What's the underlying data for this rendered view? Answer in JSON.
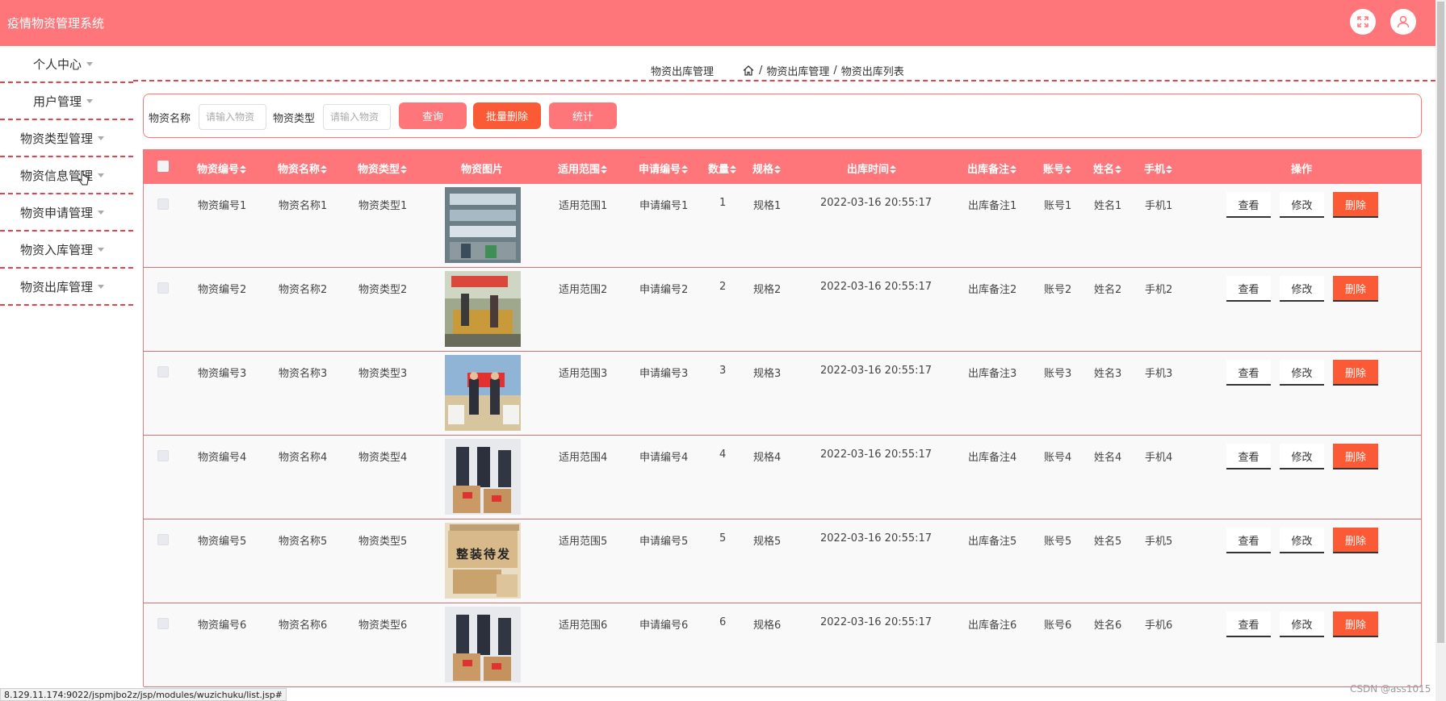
{
  "app": {
    "title": "疫情物资管理系统"
  },
  "header": {
    "fullscreen_icon": "expand-icon",
    "user_icon": "user-icon"
  },
  "sidebar": {
    "items": [
      {
        "label": "个人中心"
      },
      {
        "label": "用户管理"
      },
      {
        "label": "物资类型管理"
      },
      {
        "label": "物资信息管理"
      },
      {
        "label": "物资申请管理"
      },
      {
        "label": "物资入库管理"
      },
      {
        "label": "物资出库管理"
      }
    ]
  },
  "breadcrumb": {
    "page_title": "物资出库管理",
    "home_icon": "home-icon",
    "level1": "物资出库管理",
    "level2": "物资出库列表",
    "separator": "/"
  },
  "search": {
    "name_label": "物资名称",
    "name_placeholder": "请输入物资",
    "type_label": "物资类型",
    "type_placeholder": "请输入物资",
    "query_button": "查询",
    "batch_delete_button": "批量删除",
    "stats_button": "统计"
  },
  "colors": {
    "primary": "#ff767a",
    "danger": "#fa5a35",
    "dashed": "#e8424e"
  },
  "table": {
    "headers": {
      "code": "物资编号",
      "name": "物资名称",
      "type": "物资类型",
      "image": "物资图片",
      "scope": "适用范围",
      "apply_no": "申请编号",
      "qty": "数量",
      "spec": "规格",
      "out_time": "出库时间",
      "out_note": "出库备注",
      "account": "账号",
      "person": "姓名",
      "phone": "手机",
      "ops": "操作"
    },
    "actions": {
      "view": "查看",
      "edit": "修改",
      "delete": "删除"
    },
    "rows": [
      {
        "code": "物资编号1",
        "name": "物资名称1",
        "type": "物资类型1",
        "scope": "适用范围1",
        "apply_no": "申请编号1",
        "qty": "1",
        "spec": "规格1",
        "out_time": "2022-03-16 20:55:17",
        "out_note": "出库备注1",
        "account": "账号1",
        "person": "姓名1",
        "phone": "手机1"
      },
      {
        "code": "物资编号2",
        "name": "物资名称2",
        "type": "物资类型2",
        "scope": "适用范围2",
        "apply_no": "申请编号2",
        "qty": "2",
        "spec": "规格2",
        "out_time": "2022-03-16 20:55:17",
        "out_note": "出库备注2",
        "account": "账号2",
        "person": "姓名2",
        "phone": "手机2"
      },
      {
        "code": "物资编号3",
        "name": "物资名称3",
        "type": "物资类型3",
        "scope": "适用范围3",
        "apply_no": "申请编号3",
        "qty": "3",
        "spec": "规格3",
        "out_time": "2022-03-16 20:55:17",
        "out_note": "出库备注3",
        "account": "账号3",
        "person": "姓名3",
        "phone": "手机3"
      },
      {
        "code": "物资编号4",
        "name": "物资名称4",
        "type": "物资类型4",
        "scope": "适用范围4",
        "apply_no": "申请编号4",
        "qty": "4",
        "spec": "规格4",
        "out_time": "2022-03-16 20:55:17",
        "out_note": "出库备注4",
        "account": "账号4",
        "person": "姓名4",
        "phone": "手机4"
      },
      {
        "code": "物资编号5",
        "name": "物资名称5",
        "type": "物资类型5",
        "scope": "适用范围5",
        "apply_no": "申请编号5",
        "qty": "5",
        "spec": "规格5",
        "out_time": "2022-03-16 20:55:17",
        "out_note": "出库备注5",
        "account": "账号5",
        "person": "姓名5",
        "phone": "手机5"
      },
      {
        "code": "物资编号6",
        "name": "物资名称6",
        "type": "物资类型6",
        "scope": "适用范围6",
        "apply_no": "申请编号6",
        "qty": "6",
        "spec": "规格6",
        "out_time": "2022-03-16 20:55:17",
        "out_note": "出库备注6",
        "account": "账号6",
        "person": "姓名6",
        "phone": "手机6"
      }
    ],
    "row_images": [
      {
        "icon": "photo-shelves-icon",
        "caption": ""
      },
      {
        "icon": "photo-people-icon",
        "caption": ""
      },
      {
        "icon": "photo-banner-icon",
        "caption": ""
      },
      {
        "icon": "photo-boxes-icon",
        "caption": ""
      },
      {
        "icon": "photo-carton-icon",
        "caption": "整装待发"
      },
      {
        "icon": "photo-boxes-icon",
        "caption": ""
      }
    ]
  },
  "status_bar": {
    "url": "8.129.11.174:9022/jspmjbo2z/jsp/modules/wuzichuku/list.jsp#"
  },
  "watermark": "CSDN @ass1015"
}
